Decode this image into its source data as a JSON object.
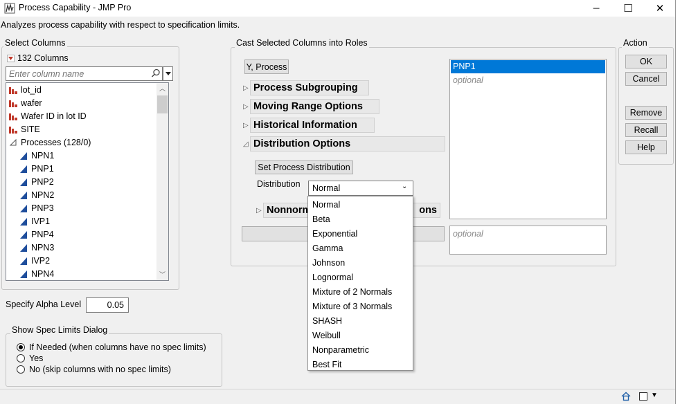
{
  "window": {
    "title": "Process Capability - JMP Pro",
    "minimize_glyph": "─",
    "maximize_glyph": "☐",
    "close_glyph": "✕"
  },
  "description": "Analyzes process capability with respect to specification limits.",
  "select_columns": {
    "title": "Select Columns",
    "count_label": "132 Columns",
    "search_placeholder": "Enter column name",
    "items": [
      {
        "label": "lot_id",
        "icon": "continuous-bar-icon",
        "indent": 0
      },
      {
        "label": "wafer",
        "icon": "continuous-bar-icon",
        "indent": 0
      },
      {
        "label": "Wafer ID in lot ID",
        "icon": "continuous-bar-icon",
        "indent": 0
      },
      {
        "label": "SITE",
        "icon": "continuous-bar-icon",
        "indent": 0
      },
      {
        "label": "Processes (128/0)",
        "icon": "group-triangle-icon",
        "indent": 0
      },
      {
        "label": "NPN1",
        "icon": "continuous-triangle-icon",
        "indent": 1
      },
      {
        "label": "PNP1",
        "icon": "continuous-triangle-icon",
        "indent": 1
      },
      {
        "label": "PNP2",
        "icon": "continuous-triangle-icon",
        "indent": 1
      },
      {
        "label": "NPN2",
        "icon": "continuous-triangle-icon",
        "indent": 1
      },
      {
        "label": "PNP3",
        "icon": "continuous-triangle-icon",
        "indent": 1
      },
      {
        "label": "IVP1",
        "icon": "continuous-triangle-icon",
        "indent": 1
      },
      {
        "label": "PNP4",
        "icon": "continuous-triangle-icon",
        "indent": 1
      },
      {
        "label": "NPN3",
        "icon": "continuous-triangle-icon",
        "indent": 1
      },
      {
        "label": "IVP2",
        "icon": "continuous-triangle-icon",
        "indent": 1
      },
      {
        "label": "NPN4",
        "icon": "continuous-triangle-icon",
        "indent": 1
      }
    ]
  },
  "alpha": {
    "label": "Specify Alpha Level",
    "value": "0.05"
  },
  "spec_limits": {
    "title": "Show Spec Limits Dialog",
    "options": [
      {
        "label": "If Needed (when columns have no spec limits)",
        "selected": true
      },
      {
        "label": "Yes",
        "selected": false
      },
      {
        "label": "No (skip columns with no spec limits)",
        "selected": false
      }
    ]
  },
  "cast": {
    "title": "Cast Selected Columns into Roles",
    "y_process_label": "Y, Process",
    "sections": [
      {
        "label": "Process Subgrouping",
        "expanded": false
      },
      {
        "label": "Moving Range Options",
        "expanded": false
      },
      {
        "label": "Historical Information",
        "expanded": false
      },
      {
        "label": "Distribution Options",
        "expanded": true
      }
    ],
    "nonnormal_section_left": "Nonnorm",
    "nonnormal_section_right": "ons",
    "set_distribution_label": "Set Process Distribution",
    "distribution_label": "Distribution",
    "distribution_value": "Normal",
    "distribution_options": [
      "Normal",
      "Beta",
      "Exponential",
      "Gamma",
      "Johnson",
      "Lognormal",
      "Mixture of 2 Normals",
      "Mixture of 3 Normals",
      "SHASH",
      "Weibull",
      "Nonparametric",
      "Best Fit"
    ],
    "role_y_values": [
      "PNP1"
    ],
    "optional_placeholder": "optional"
  },
  "action": {
    "title": "Action",
    "ok": "OK",
    "cancel": "Cancel",
    "remove": "Remove",
    "recall": "Recall",
    "help": "Help"
  },
  "colors": {
    "selection": "#0078d7",
    "continuous_icon": "#c0392b",
    "triangle_icon": "#1f4e9c"
  }
}
